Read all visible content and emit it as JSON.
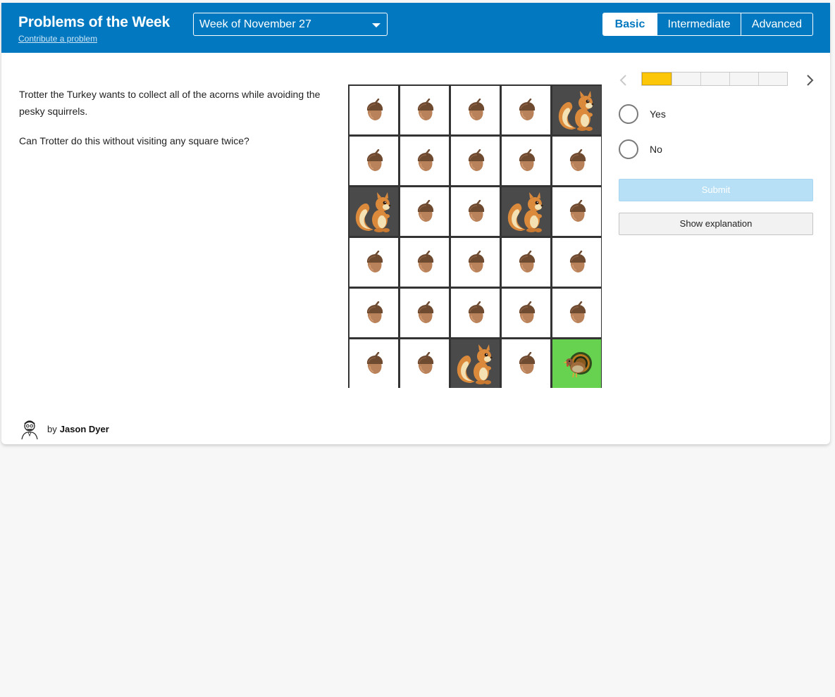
{
  "header": {
    "title": "Problems of the Week",
    "contribute_link": "Contribute a problem",
    "week_selected": "Week of November 27",
    "levels": [
      "Basic",
      "Intermediate",
      "Advanced"
    ],
    "active_level": "Basic",
    "accent_color": "#0178bf"
  },
  "problem": {
    "paragraph_1": "Trotter the Turkey wants to collect all of the acorns while avoiding the pesky squirrels.",
    "paragraph_2": "Can Trotter do this without visiting any square twice?"
  },
  "grid": {
    "columns": 5,
    "rows": 6,
    "cells": [
      [
        "acorn",
        "acorn",
        "acorn",
        "acorn",
        "squirrel"
      ],
      [
        "acorn",
        "acorn",
        "acorn",
        "acorn",
        "acorn"
      ],
      [
        "squirrel",
        "acorn",
        "acorn",
        "squirrel",
        "acorn"
      ],
      [
        "acorn",
        "acorn",
        "acorn",
        "acorn",
        "acorn"
      ],
      [
        "acorn",
        "acorn",
        "acorn",
        "acorn",
        "acorn"
      ],
      [
        "acorn",
        "acorn",
        "squirrel",
        "acorn",
        "turkey"
      ]
    ],
    "squirrel_cell_color": "#4a4a4a",
    "turkey_cell_color": "#66d24f"
  },
  "progress": {
    "segments": 5,
    "completed": 1,
    "fill_color": "#fbc708"
  },
  "answers": {
    "options": [
      "Yes",
      "No"
    ]
  },
  "actions": {
    "submit_label": "Submit",
    "explanation_label": "Show explanation"
  },
  "author": {
    "by_label": "by",
    "name": "Jason Dyer"
  }
}
